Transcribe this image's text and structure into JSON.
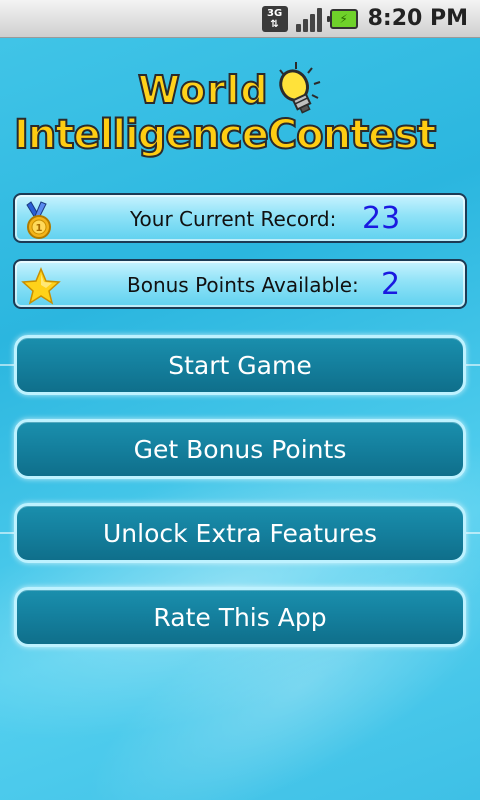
{
  "status_bar": {
    "network": "3G",
    "time": "8:20 PM",
    "icons": [
      "3g-data-icon",
      "signal-strength-icon",
      "battery-charging-icon"
    ]
  },
  "logo": {
    "line1": "World",
    "line2": "IntelligenceContest"
  },
  "record": {
    "label": "Your Current Record:",
    "value": "23"
  },
  "bonus": {
    "label": "Bonus Points Available:",
    "value": "2"
  },
  "menu": {
    "start_label": "Start Game",
    "get_bonus_label": "Get Bonus Points",
    "unlock_label": "Unlock Extra Features",
    "rate_label": "Rate This App"
  },
  "colors": {
    "background": "#3ec0e6",
    "button": "#147f9d",
    "button_border": "#bdf2ff",
    "value_text": "#1a1ae0",
    "logo_yellow": "#ffcd12"
  }
}
